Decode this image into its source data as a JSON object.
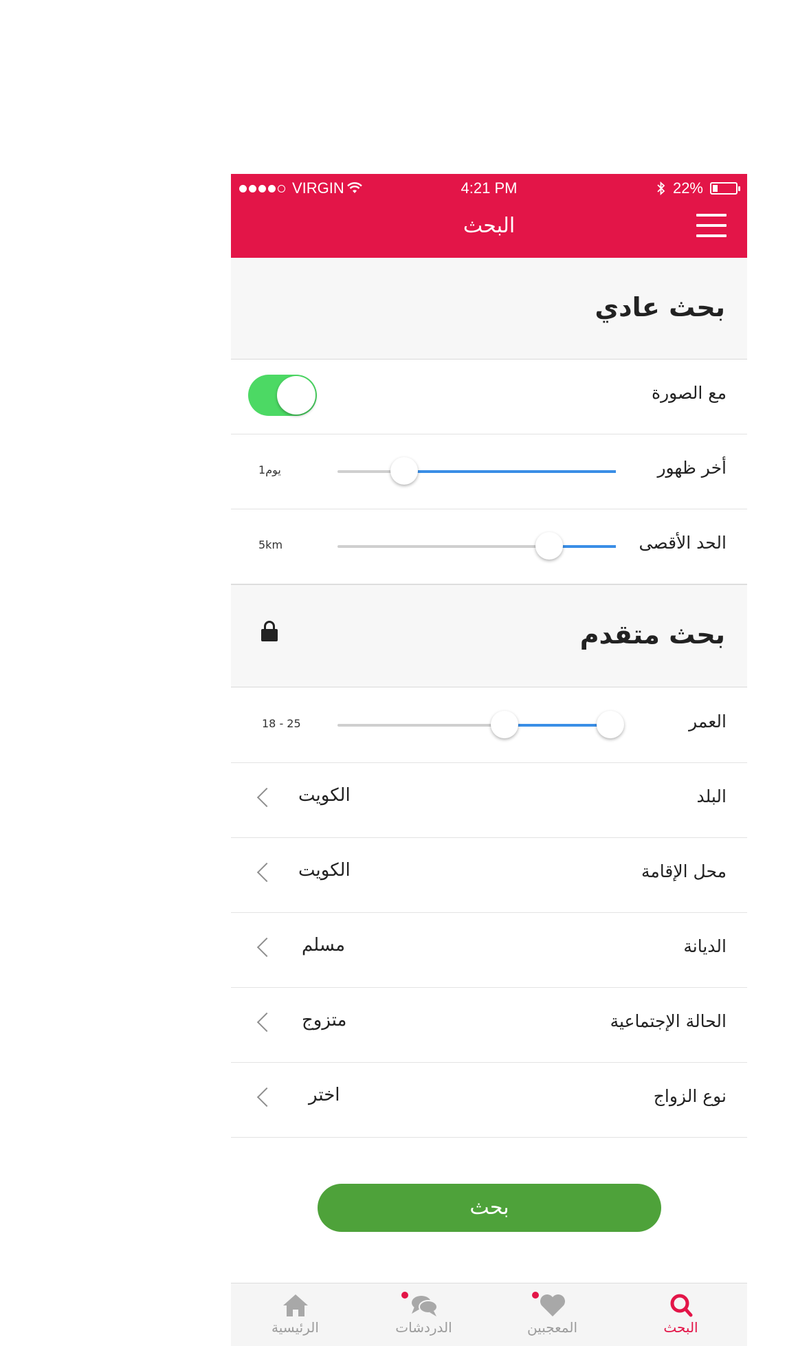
{
  "status_bar": {
    "carrier": "VIRGIN",
    "time": "4:21 PM",
    "battery": "22%",
    "battery_level": 0.22
  },
  "nav": {
    "title": "البحث"
  },
  "basic": {
    "title": "بحث عادي",
    "with_photo_label": "مع الصورة",
    "with_photo_on": true,
    "last_seen_label": "أخر ظهور",
    "last_seen_value": "1يوم",
    "last_seen_fraction": 0.24,
    "max_distance_label": "الحد الأقصى",
    "max_distance_value": "5km",
    "max_distance_fraction": 0.76
  },
  "advanced": {
    "title": "بحث متقدم",
    "lock_icon": "lock-icon",
    "age_label": "العمر",
    "age_value": "18 - 25",
    "age_range_fraction": [
      0.6,
      0.98
    ],
    "rows": [
      {
        "label": "البلد",
        "value": "الكويت"
      },
      {
        "label": "محل الإقامة",
        "value": "الكويت"
      },
      {
        "label": "الديانة",
        "value": "مسلم"
      },
      {
        "label": "الحالة الإجتماعية",
        "value": "متزوج"
      },
      {
        "label": "نوع الزواج",
        "value": "اختر"
      }
    ]
  },
  "search_button": "بحث",
  "tabs": [
    {
      "label": "الرئيسية",
      "icon": "home-icon",
      "active": false,
      "badge": false
    },
    {
      "label": "الدردشات",
      "icon": "chat-icon",
      "active": false,
      "badge": true
    },
    {
      "label": "المعجبين",
      "icon": "heart-icon",
      "active": false,
      "badge": true
    },
    {
      "label": "البحث",
      "icon": "search-icon",
      "active": true,
      "badge": false
    }
  ],
  "colors": {
    "brand": "#E31548",
    "toggle_on": "#4CD964",
    "slider": "#3A8EE6",
    "button": "#4EA23A"
  }
}
